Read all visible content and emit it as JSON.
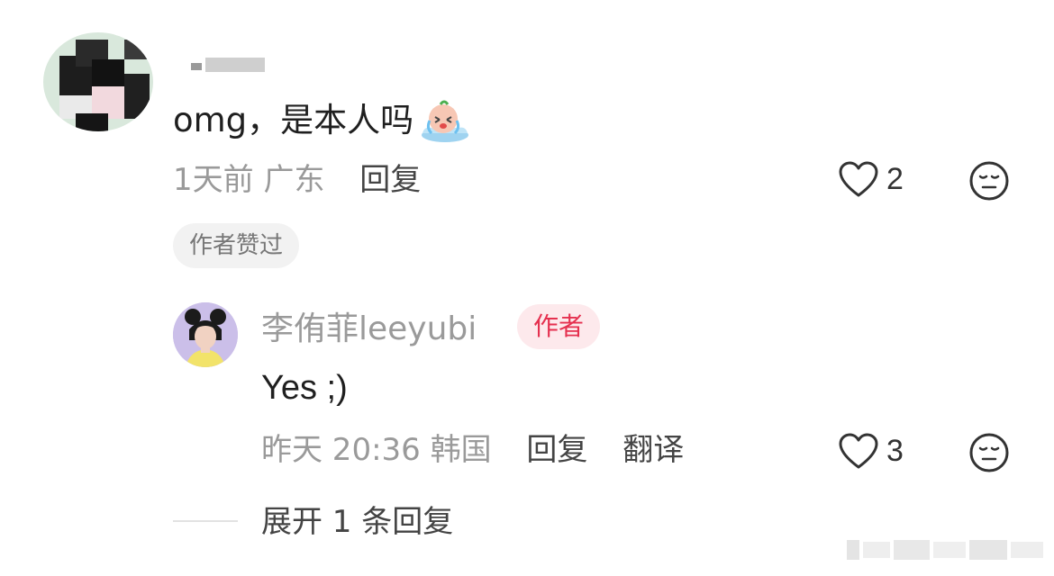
{
  "comment": {
    "text": "omg，是本人吗",
    "emoji": "crying-face-emoji",
    "time_location": "1天前 广东",
    "reply_label": "回复",
    "like_count": "2",
    "liked_tag": "作者赞过"
  },
  "reply": {
    "author_name": "李侑菲leeyubi",
    "author_badge": "作者",
    "text": "Yes ;)",
    "time_location": "昨天 20:36 韩国",
    "reply_label": "回复",
    "translate_label": "翻译",
    "like_count": "3"
  },
  "expand": {
    "label": "展开 1 条回复"
  },
  "colors": {
    "author_badge_text": "#e5304f",
    "author_badge_bg": "#fde9ec",
    "muted_text": "#9a9a9a",
    "primary_text": "#1f1f1f"
  },
  "icons": {
    "like": "heart-outline-icon",
    "dislike": "meh-face-icon"
  }
}
